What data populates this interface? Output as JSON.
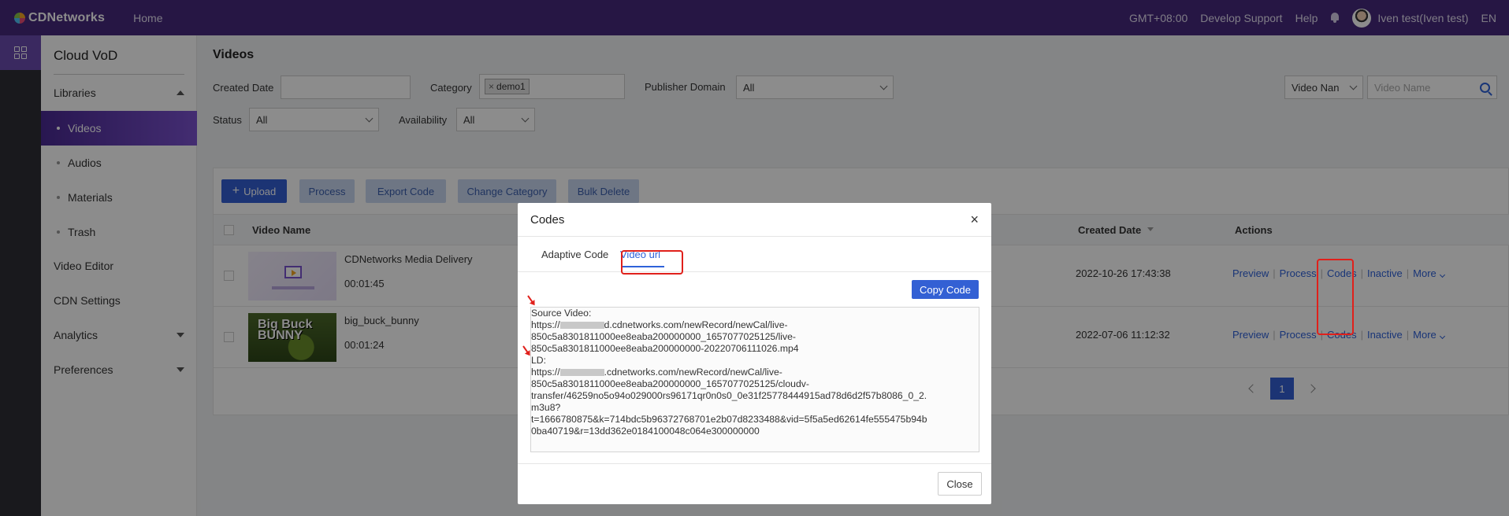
{
  "topbar": {
    "brand": "CDNetworks",
    "home": "Home",
    "timezone": "GMT+08:00",
    "develop_support": "Develop Support",
    "help": "Help",
    "user": "Iven test(Iven test)",
    "lang": "EN"
  },
  "sidebar": {
    "title": "Cloud VoD",
    "libraries": "Libraries",
    "sub_items": [
      "Videos",
      "Audios",
      "Materials",
      "Trash"
    ],
    "video_editor": "Video Editor",
    "cdn_settings": "CDN Settings",
    "analytics": "Analytics",
    "preferences": "Preferences"
  },
  "filters": {
    "page_title": "Videos",
    "created_date_label": "Created Date",
    "created_date_value": "",
    "category_label": "Category",
    "category_tag": "demo1",
    "publisher_label": "Publisher Domain",
    "publisher_value": "All",
    "status_label": "Status",
    "status_value": "All",
    "availability_label": "Availability",
    "availability_value": "All",
    "search_field": "Video Nan",
    "search_placeholder": "Video Name"
  },
  "toolbar": {
    "upload": "Upload",
    "process": "Process",
    "export_code": "Export Code",
    "change_category": "Change Category",
    "bulk_delete": "Bulk Delete"
  },
  "table": {
    "col_video_name": "Video Name",
    "col_created_date": "Created Date",
    "col_actions": "Actions",
    "rows": [
      {
        "name": "CDNetworks Media Delivery",
        "duration": "00:01:45",
        "date": "2022-10-26 17:43:38"
      },
      {
        "name": "big_buck_bunny",
        "duration": "00:01:24",
        "date": "2022-07-06 11:12:32"
      }
    ],
    "actions": {
      "preview": "Preview",
      "process": "Process",
      "codes": "Codes",
      "inactive": "Inactive",
      "more": "More"
    },
    "thumb2_text": "Big Buck BUNNY"
  },
  "pager": {
    "current": "1"
  },
  "modal": {
    "title": "Codes",
    "close_x": "×",
    "tabs": [
      "Adaptive Code",
      "Video url"
    ],
    "copy_button": "Copy Code",
    "code_lines": [
      "Source Video:",
      "https://",
      "d.cdnetworks.com/newRecord/newCal/live-",
      "850c5a8301811000ee8eaba200000000_1657077025125/live-",
      "850c5a8301811000ee8eaba200000000-20220706111026.mp4",
      "LD:",
      "https://",
      ".cdnetworks.com/newRecord/newCal/live-",
      "850c5a8301811000ee8eaba200000000_1657077025125/cloudv-",
      "transfer/46259no5o94o029000rs96171qr0n0s0_0e31f25778444915ad78d6d2f57b8086_0_2.",
      "m3u8?",
      "t=1666780875&k=714bdc5b96372768701e2b07d8233488&vid=5f5a5ed62614fe555475b94b",
      "0ba40719&r=13dd362e0184100048c064e300000000"
    ],
    "close_button": "Close"
  },
  "colors": {
    "topbar": "#45297c",
    "accent": "#3360d4",
    "annotation": "#e0201b"
  }
}
